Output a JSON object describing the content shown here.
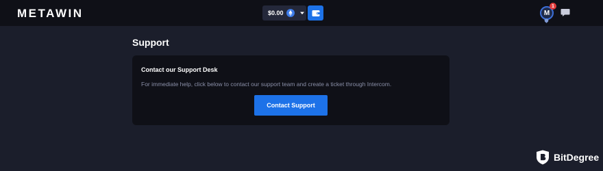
{
  "header": {
    "logo": "METAWIN",
    "balance": {
      "value": "$0.00",
      "currency_icon": "ethereum-icon",
      "dropdown_icon": "caret-down-icon"
    },
    "wallet_icon": "wallet-icon",
    "notifications": {
      "count": "1"
    },
    "avatar_label": "M",
    "chat_icon": "chat-bubble-icon"
  },
  "main": {
    "title": "Support",
    "card": {
      "title": "Contact our Support Desk",
      "description": "For immediate help, click below to contact our support team and create a ticket through Intercom.",
      "button_label": "Contact Support"
    }
  },
  "watermark": {
    "text": "BitDegree",
    "icon": "bitdegree-shield-icon"
  },
  "colors": {
    "accent": "#1d72e8",
    "background": "#1b1e2b",
    "panel": "#0f1017",
    "muted_text": "#8a8fa8",
    "badge": "#e23b3b"
  }
}
